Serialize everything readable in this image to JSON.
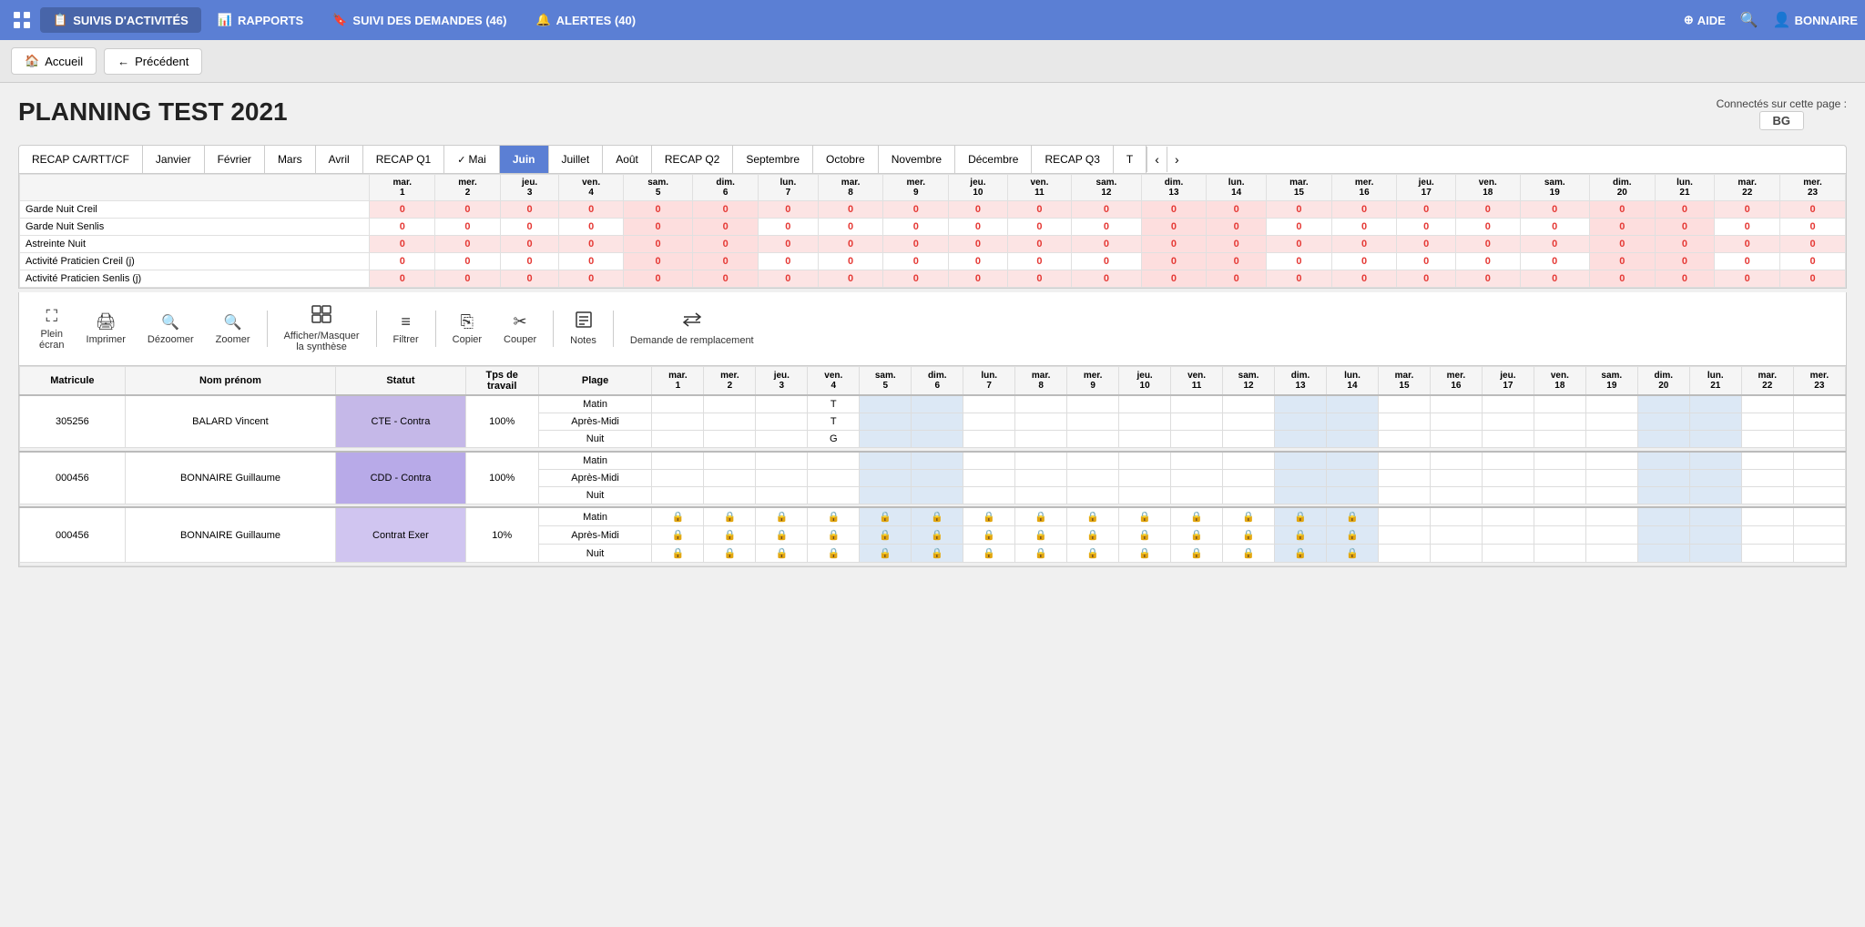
{
  "nav": {
    "grid_icon": "⊞",
    "items": [
      {
        "id": "suivis",
        "label": "SUIVIS D'ACTIVITÉS",
        "icon": "📋",
        "active": true
      },
      {
        "id": "rapports",
        "label": "RAPPORTS",
        "icon": "📊",
        "active": false
      },
      {
        "id": "suivi_demandes",
        "label": "SUIVI DES DEMANDES (46)",
        "icon": "🔖",
        "active": false
      },
      {
        "id": "alertes",
        "label": "ALERTES (40)",
        "icon": "🔔",
        "active": false
      }
    ],
    "right": {
      "aide": "AIDE",
      "user": "BONNAIRE"
    }
  },
  "secondary": {
    "accueil": "Accueil",
    "precedent": "Précédent"
  },
  "page": {
    "title": "PLANNING TEST 2021",
    "connected_label": "Connectés sur cette page :",
    "connected_user": "BG"
  },
  "tabs": [
    {
      "id": "recap_ca",
      "label": "RECAP CA/RTT/CF"
    },
    {
      "id": "janvier",
      "label": "Janvier"
    },
    {
      "id": "fevrier",
      "label": "Février"
    },
    {
      "id": "mars",
      "label": "Mars"
    },
    {
      "id": "avril",
      "label": "Avril"
    },
    {
      "id": "recap_q1",
      "label": "RECAP Q1"
    },
    {
      "id": "mai",
      "label": "Mai",
      "checked": true
    },
    {
      "id": "juin",
      "label": "Juin",
      "active": true
    },
    {
      "id": "juillet",
      "label": "Juillet"
    },
    {
      "id": "aout",
      "label": "Août"
    },
    {
      "id": "recap_q2",
      "label": "RECAP Q2"
    },
    {
      "id": "septembre",
      "label": "Septembre"
    },
    {
      "id": "octobre",
      "label": "Octobre"
    },
    {
      "id": "novembre",
      "label": "Novembre"
    },
    {
      "id": "decembre",
      "label": "Décembre"
    },
    {
      "id": "recap_q3",
      "label": "RECAP Q3"
    },
    {
      "id": "t",
      "label": "T"
    }
  ],
  "summary_headers": {
    "days": [
      "mar.\n1",
      "mer.\n2",
      "jeu.\n3",
      "ven.\n4",
      "sam.\n5",
      "dim.\n6",
      "lun.\n7",
      "mar.\n8",
      "mer.\n9",
      "jeu.\n10",
      "ven.\n11",
      "sam.\n12",
      "dim.\n13",
      "lun.\n14",
      "mar.\n15",
      "mer.\n16",
      "jeu.\n17",
      "ven.\n18",
      "sam.\n19",
      "dim.\n20",
      "lun.\n21",
      "mar.\n22",
      "mer.\n23"
    ]
  },
  "summary_rows": [
    {
      "label": "Garde Nuit Creil",
      "style": "light-red",
      "values": [
        "0",
        "0",
        "0",
        "0",
        "0",
        "0",
        "0",
        "0",
        "0",
        "0",
        "0",
        "0",
        "0",
        "0",
        "0",
        "0",
        "0",
        "0",
        "0",
        "0",
        "0",
        "0",
        "0"
      ]
    },
    {
      "label": "Garde Nuit Senlis",
      "style": "white",
      "values": [
        "0",
        "0",
        "0",
        "0",
        "0",
        "0",
        "0",
        "0",
        "0",
        "0",
        "0",
        "0",
        "0",
        "0",
        "0",
        "0",
        "0",
        "0",
        "0",
        "0",
        "0",
        "0",
        "0"
      ]
    },
    {
      "label": "Astreinte Nuit",
      "style": "light-red",
      "values": [
        "0",
        "0",
        "0",
        "0",
        "0",
        "0",
        "0",
        "0",
        "0",
        "0",
        "0",
        "0",
        "0",
        "0",
        "0",
        "0",
        "0",
        "0",
        "0",
        "0",
        "0",
        "0",
        "0"
      ]
    },
    {
      "label": "Activité Praticien Creil (j)",
      "style": "white",
      "values": [
        "0",
        "0",
        "0",
        "0",
        "0",
        "0",
        "0",
        "0",
        "0",
        "0",
        "0",
        "0",
        "0",
        "0",
        "0",
        "0",
        "0",
        "0",
        "0",
        "0",
        "0",
        "0",
        "0"
      ]
    },
    {
      "label": "Activité Praticien Senlis (j)",
      "style": "light-red",
      "values": [
        "0",
        "0",
        "0",
        "0",
        "0",
        "0",
        "0",
        "0",
        "0",
        "0",
        "0",
        "0",
        "0",
        "0",
        "0",
        "0",
        "0",
        "0",
        "0",
        "0",
        "0",
        "0",
        "0"
      ]
    }
  ],
  "toolbar_buttons": [
    {
      "id": "plein_ecran",
      "icon": "⛶",
      "label": "Plein\nécran"
    },
    {
      "id": "imprimer",
      "icon": "🖨",
      "label": "Imprimer"
    },
    {
      "id": "dezoomer",
      "icon": "🔍",
      "label": "Dézoomer"
    },
    {
      "id": "zoomer",
      "icon": "🔍",
      "label": "Zoomer"
    },
    {
      "id": "afficher_masquer",
      "icon": "⊞",
      "label": "Afficher/Masquer\nla synthèse"
    },
    {
      "id": "filtrer",
      "icon": "≡",
      "label": "Filtrer"
    },
    {
      "id": "copier",
      "icon": "⎘",
      "label": "Copier"
    },
    {
      "id": "couper",
      "icon": "✂",
      "label": "Couper"
    },
    {
      "id": "notes",
      "icon": "≡",
      "label": "Notes"
    },
    {
      "id": "demande_remplacement",
      "icon": "⇄",
      "label": "Demande de remplacement"
    }
  ],
  "planning_headers": {
    "cols": [
      "Matricule",
      "Nom prénom",
      "Statut",
      "Tps de\ntravail",
      "Plage"
    ],
    "days": [
      "mar.\n1",
      "mer.\n2",
      "jeu.\n3",
      "ven.\n4",
      "sam.\n5",
      "dim.\n6",
      "lun.\n7",
      "mar.\n8",
      "mer.\n9",
      "jeu.\n10",
      "ven.\n11",
      "sam.\n12",
      "dim.\n13",
      "lun.\n14",
      "mar.\n15",
      "mer.\n16",
      "jeu.\n17",
      "ven.\n18",
      "sam.\n19",
      "dim.\n20",
      "lun.\n21",
      "mar.\n22",
      "mer.\n23"
    ]
  },
  "planning_rows": [
    {
      "matricule": "305256",
      "nom": "BALARD Vincent",
      "statut": "CTE - Contra",
      "statut_style": "cte",
      "tps": "100%",
      "plages": [
        "Matin",
        "Après-Midi",
        "Nuit"
      ],
      "values": {
        "Matin": [
          "",
          "",
          "",
          "T",
          "",
          "",
          "",
          "",
          "",
          "",
          "",
          "",
          "",
          "",
          "",
          "",
          "",
          "",
          "",
          "",
          "",
          "",
          ""
        ],
        "Après-Midi": [
          "",
          "",
          "",
          "T",
          "",
          "",
          "",
          "",
          "",
          "",
          "",
          "",
          "",
          "",
          "",
          "",
          "",
          "",
          "",
          "",
          "",
          "",
          ""
        ],
        "Nuit": [
          "",
          "",
          "",
          "G",
          "",
          "",
          "",
          "",
          "",
          "",
          "",
          "",
          "",
          "",
          "",
          "",
          "",
          "",
          "",
          "",
          "",
          "",
          ""
        ]
      },
      "weekend_cols": [
        4,
        5,
        12,
        13,
        19,
        20
      ]
    },
    {
      "matricule": "000456",
      "nom": "BONNAIRE Guillaume",
      "statut": "CDD - Contra",
      "statut_style": "cdd",
      "tps": "100%",
      "plages": [
        "Matin",
        "Après-Midi",
        "Nuit"
      ],
      "values": {
        "Matin": [
          "",
          "",
          "",
          "",
          "",
          "",
          "",
          "",
          "",
          "",
          "",
          "",
          "",
          "",
          "",
          "",
          "",
          "",
          "",
          "",
          "",
          "",
          ""
        ],
        "Après-Midi": [
          "",
          "",
          "",
          "",
          "",
          "",
          "",
          "",
          "",
          "",
          "",
          "",
          "",
          "",
          "",
          "",
          "",
          "",
          "",
          "",
          "",
          "",
          ""
        ],
        "Nuit": [
          "",
          "",
          "",
          "",
          "",
          "",
          "",
          "",
          "",
          "",
          "",
          "",
          "",
          "",
          "",
          "",
          "",
          "",
          "",
          "",
          "",
          "",
          ""
        ]
      },
      "weekend_cols": [
        4,
        5,
        12,
        13,
        19,
        20
      ]
    },
    {
      "matricule": "000456",
      "nom": "BONNAIRE Guillaume",
      "statut": "Contrat Exer",
      "statut_style": "contrat",
      "tps": "10%",
      "plages": [
        "Matin",
        "Après-Midi",
        "Nuit"
      ],
      "locked": true,
      "values": {
        "Matin": [
          "🔒",
          "🔒",
          "🔒",
          "🔒",
          "🔒",
          "🔒",
          "🔒",
          "🔒",
          "🔒",
          "🔒",
          "🔒",
          "🔒",
          "🔒",
          "🔒",
          "",
          "",
          "",
          "",
          "",
          "",
          "",
          "",
          ""
        ],
        "Après-Midi": [
          "🔒",
          "🔒",
          "🔒",
          "🔒",
          "🔒",
          "🔒",
          "🔒",
          "🔒",
          "🔒",
          "🔒",
          "🔒",
          "🔒",
          "🔒",
          "🔒",
          "",
          "",
          "",
          "",
          "",
          "",
          "",
          "",
          ""
        ],
        "Nuit": [
          "🔒",
          "🔒",
          "🔒",
          "🔒",
          "🔒",
          "🔒",
          "🔒",
          "🔒",
          "🔒",
          "🔒",
          "🔒",
          "🔒",
          "🔒",
          "🔒",
          "",
          "",
          "",
          "",
          "",
          "",
          "",
          "",
          ""
        ]
      },
      "weekend_cols": [
        4,
        5,
        12,
        13,
        19,
        20
      ]
    }
  ]
}
